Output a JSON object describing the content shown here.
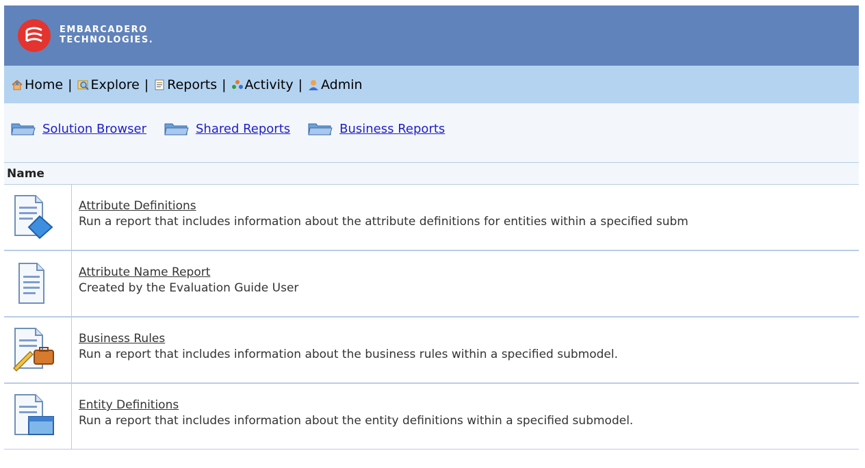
{
  "brand": {
    "line1": "EMBARCADERO",
    "line2": "TECHNOLOGIES."
  },
  "nav": {
    "items": [
      {
        "label": "Home",
        "icon": "home-icon"
      },
      {
        "label": "Explore",
        "icon": "explore-icon"
      },
      {
        "label": "Reports",
        "icon": "reports-icon"
      },
      {
        "label": "Activity",
        "icon": "activity-icon"
      },
      {
        "label": "Admin",
        "icon": "admin-icon"
      }
    ],
    "separator": "|"
  },
  "breadcrumbs": [
    {
      "label": "Solution Browser"
    },
    {
      "label": "Shared Reports"
    },
    {
      "label": "Business Reports"
    }
  ],
  "table": {
    "header": "Name",
    "rows": [
      {
        "title": "Attribute Definitions",
        "description": "Run a report that includes information about the attribute definitions for entities within a specified subm",
        "icon": "attribute-report-icon"
      },
      {
        "title": "Attribute Name Report",
        "description": "Created by the Evaluation Guide User",
        "icon": "document-icon"
      },
      {
        "title": "Business Rules",
        "description": "Run a report that includes information about the business rules within a specified submodel.",
        "icon": "business-report-icon"
      },
      {
        "title": "Entity Definitions",
        "description": "Run a report that includes information about the entity definitions within a specified submodel.",
        "icon": "entity-report-icon"
      }
    ]
  },
  "colors": {
    "header_bg": "#6183bb",
    "nav_bg": "#b4d3f1",
    "link": "#1f1ec9",
    "logo_red": "#e3342f"
  }
}
